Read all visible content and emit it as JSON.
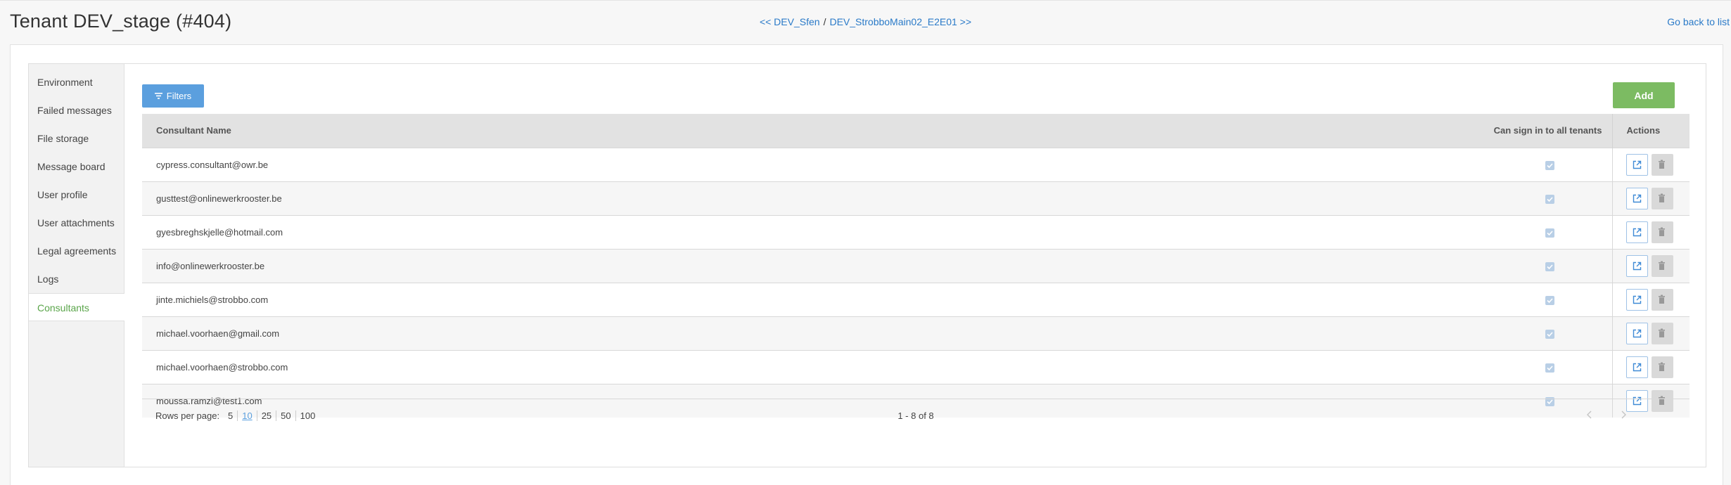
{
  "header": {
    "title": "Tenant DEV_stage (#404)",
    "prev_link": "<< DEV_Sfen",
    "separator": "/",
    "next_link": "DEV_StrobboMain02_E2E01 >>",
    "back_link": "Go back to list"
  },
  "sidebar": {
    "items": [
      {
        "label": "Environment"
      },
      {
        "label": "Failed messages"
      },
      {
        "label": "File storage"
      },
      {
        "label": "Message board"
      },
      {
        "label": "User profile"
      },
      {
        "label": "User attachments"
      },
      {
        "label": "Legal agreements"
      },
      {
        "label": "Logs"
      },
      {
        "label": "Consultants",
        "active": true
      }
    ]
  },
  "toolbar": {
    "filters_label": "Filters",
    "filters_icon": "filter-icon",
    "add_label": "Add"
  },
  "table": {
    "columns": {
      "name": "Consultant Name",
      "sign_in": "Can sign in to all tenants",
      "actions": "Actions"
    },
    "rows": [
      {
        "name": "cypress.consultant@owr.be",
        "can_sign_in": true
      },
      {
        "name": "gusttest@onlinewerkrooster.be",
        "can_sign_in": true
      },
      {
        "name": "gyesbreghskjelle@hotmail.com",
        "can_sign_in": true
      },
      {
        "name": "info@onlinewerkrooster.be",
        "can_sign_in": true
      },
      {
        "name": "jinte.michiels@strobbo.com",
        "can_sign_in": true
      },
      {
        "name": "michael.voorhaen@gmail.com",
        "can_sign_in": true
      },
      {
        "name": "michael.voorhaen@strobbo.com",
        "can_sign_in": true
      },
      {
        "name": "moussa.ramzi@test1.com",
        "can_sign_in": true
      }
    ]
  },
  "pagination": {
    "rows_per_page_label": "Rows per page:",
    "page_sizes": [
      "5",
      "10",
      "25",
      "50",
      "100"
    ],
    "selected_page_size": "10",
    "range_text": "1 - 8 of 8"
  },
  "colors": {
    "filters_button": "#5b9fde",
    "add_button": "#7cbb62",
    "active_sidebar": "#5aa54a",
    "link": "#2a7ac8"
  }
}
